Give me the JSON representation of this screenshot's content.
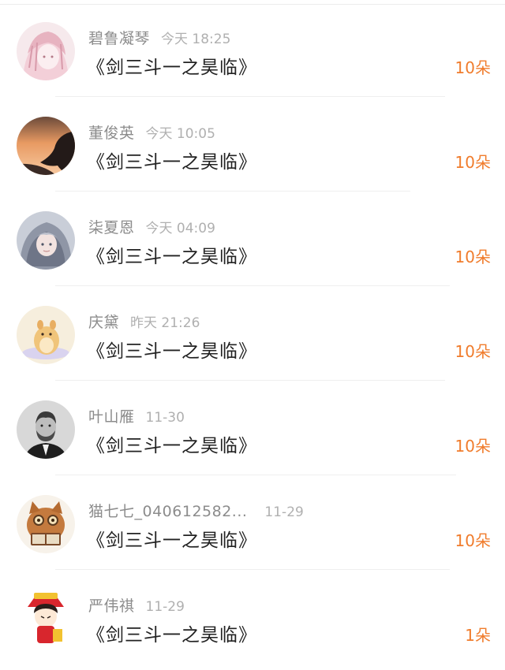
{
  "messages": [
    {
      "user": "碧鲁凝琴",
      "time": "今天 18:25",
      "title": "《剑三斗一之昊临》",
      "amount": "10朵",
      "avatar_icon": "anime-girl-avatar-icon"
    },
    {
      "user": "董俊英",
      "time": "今天 10:05",
      "title": "《剑三斗一之昊临》",
      "amount": "10朵",
      "avatar_icon": "sunset-silhouette-avatar-icon"
    },
    {
      "user": "柒夏恩",
      "time": "今天 04:09",
      "title": "《剑三斗一之昊临》",
      "amount": "10朵",
      "avatar_icon": "silver-hair-girl-avatar-icon"
    },
    {
      "user": "庆黛",
      "time": "昨天 21:26",
      "title": "《剑三斗一之昊临》",
      "amount": "10朵",
      "avatar_icon": "hamster-avatar-icon"
    },
    {
      "user": "叶山雁",
      "time": "11-30",
      "title": "《剑三斗一之昊临》",
      "amount": "10朵",
      "avatar_icon": "bearded-man-avatar-icon"
    },
    {
      "user": "猫七七_040612582...",
      "time": "11-29",
      "title": "《剑三斗一之昊临》",
      "amount": "10朵",
      "avatar_icon": "reading-cat-avatar-icon"
    },
    {
      "user": "严伟祺",
      "time": "11-29",
      "title": "《剑三斗一之昊临》",
      "amount": "1朵",
      "avatar_icon": "chibi-girl-avatar-icon"
    }
  ],
  "colors": {
    "amount": "#f07c2c",
    "username": "#8c8c8c",
    "time": "#b0b0b0",
    "title": "#222222"
  }
}
